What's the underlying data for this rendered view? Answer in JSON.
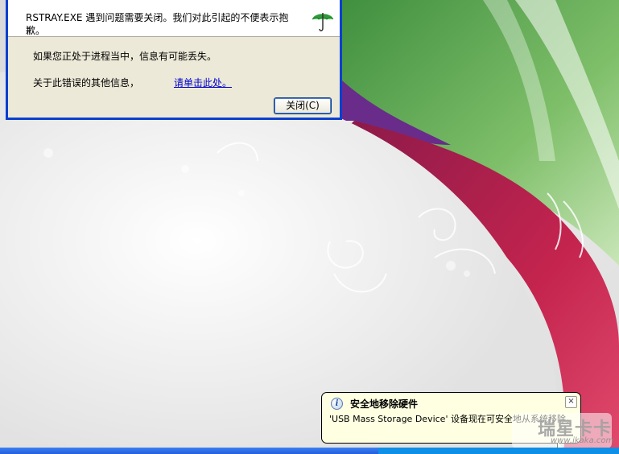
{
  "dialog": {
    "message": "RSTRAY.EXE 遇到问题需要关闭。我们对此引起的不便表示抱歉。",
    "line1": "如果您正处于进程当中，信息有可能丢失。",
    "line2": "关于此错误的其他信息，",
    "link": "请单击此处。",
    "close_button": "关闭(C)",
    "icon": "umbrella-icon"
  },
  "balloon": {
    "title": "安全地移除硬件",
    "body": "'USB Mass Storage Device' 设备现在可安全地从系统移除。",
    "close_glyph": "×",
    "info_glyph": "i",
    "icon": "info-icon"
  },
  "watermark": {
    "text": "瑞星卡卡",
    "url": "www.ikaka.com"
  },
  "colors": {
    "dialog_border": "#0a3fd0",
    "dialog_bg": "#ece9d8",
    "balloon_bg": "#ffffe1",
    "link": "#0000cc",
    "taskbar": "#245edb"
  }
}
